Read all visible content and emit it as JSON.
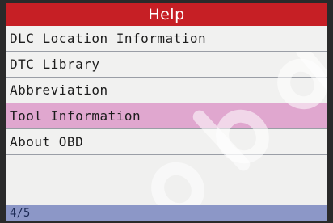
{
  "header": {
    "title": "Help"
  },
  "menu": {
    "items": [
      {
        "label": "DLC Location Information",
        "selected": false
      },
      {
        "label": "DTC Library",
        "selected": false
      },
      {
        "label": "Abbreviation",
        "selected": false
      },
      {
        "label": "Tool Information",
        "selected": true
      },
      {
        "label": "About OBD",
        "selected": false
      }
    ]
  },
  "status": {
    "page": "4/5"
  },
  "watermark": {
    "text": "obd"
  },
  "colors": {
    "title_bar": "#c61f25",
    "selected_row": "#e0a7cf",
    "status_bar": "#8c97c7",
    "background": "#f0f0ef"
  }
}
